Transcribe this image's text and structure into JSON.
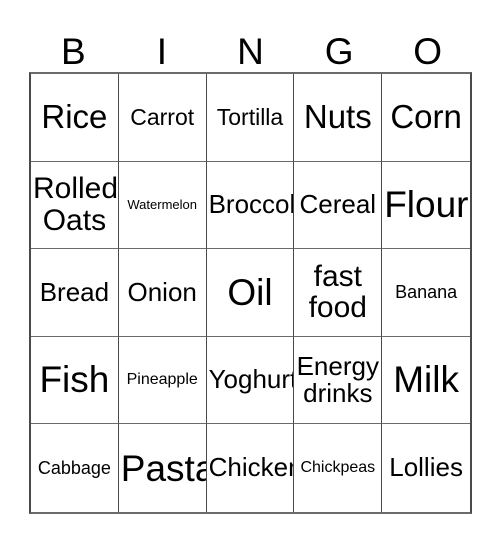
{
  "card": {
    "title": "BINGO",
    "header_letters": [
      "B",
      "I",
      "N",
      "G",
      "O"
    ],
    "grid_size": "5x5",
    "colors": {
      "background": "#ffffff",
      "text": "#000000",
      "border": "#4a4a4a"
    },
    "rows": [
      [
        {
          "text": "Rice",
          "size": "t-xl"
        },
        {
          "text": "Carrot",
          "size": "t-sm"
        },
        {
          "text": "Tortilla",
          "size": "t-sm"
        },
        {
          "text": "Nuts",
          "size": "t-xl"
        },
        {
          "text": "Corn",
          "size": "t-xl"
        }
      ],
      [
        {
          "text": "Rolled\nOats",
          "size": "t-lg"
        },
        {
          "text": "Watermelon",
          "size": "t-tiny"
        },
        {
          "text": "Broccoli",
          "size": "t-md"
        },
        {
          "text": "Cereal",
          "size": "t-md"
        },
        {
          "text": "Flour",
          "size": "t-xxl"
        }
      ],
      [
        {
          "text": "Bread",
          "size": "t-md"
        },
        {
          "text": "Onion",
          "size": "t-md"
        },
        {
          "text": "Oil",
          "size": "t-xxl"
        },
        {
          "text": "fast\nfood",
          "size": "t-lg"
        },
        {
          "text": "Banana",
          "size": "t-xs"
        }
      ],
      [
        {
          "text": "Fish",
          "size": "t-xxl"
        },
        {
          "text": "Pineapple",
          "size": "t-xxs"
        },
        {
          "text": "Yoghurt",
          "size": "t-md"
        },
        {
          "text": "Energy\ndrinks",
          "size": "t-md"
        },
        {
          "text": "Milk",
          "size": "t-xxl"
        }
      ],
      [
        {
          "text": "Cabbage",
          "size": "t-xs"
        },
        {
          "text": "Pasta",
          "size": "t-xxl"
        },
        {
          "text": "Chicken",
          "size": "t-md"
        },
        {
          "text": "Chickpeas",
          "size": "t-xxs"
        },
        {
          "text": "Lollies",
          "size": "t-md"
        }
      ]
    ]
  }
}
